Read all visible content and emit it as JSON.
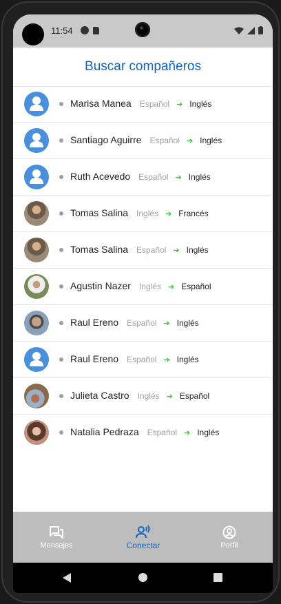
{
  "status_bar": {
    "time": "11:54"
  },
  "header": {
    "title": "Buscar compañeros"
  },
  "colors": {
    "accent": "#1565c0",
    "arrow": "#3cc43c",
    "avatar_default": "#4a8fdb",
    "nav_bg": "#bdbdbd"
  },
  "partners": [
    {
      "name": "Marisa Manea",
      "from": "Español",
      "to": "Inglés",
      "avatar": "default"
    },
    {
      "name": "Santiago Aguirre",
      "from": "Español",
      "to": "Inglés",
      "avatar": "default"
    },
    {
      "name": "Ruth Acevedo",
      "from": "Español",
      "to": "Inglés",
      "avatar": "default"
    },
    {
      "name": "Tomas Salina",
      "from": "Inglés",
      "to": "Francés",
      "avatar": "photo"
    },
    {
      "name": "Tomas Salina",
      "from": "Español",
      "to": "Inglés",
      "avatar": "photo"
    },
    {
      "name": "Agustin Nazer",
      "from": "Inglés",
      "to": "Español",
      "avatar": "photo"
    },
    {
      "name": "Raul Ereno",
      "from": "Español",
      "to": "Inglés",
      "avatar": "photo"
    },
    {
      "name": "Raul Ereno",
      "from": "Español",
      "to": "Inglés",
      "avatar": "default"
    },
    {
      "name": "Julieta Castro",
      "from": "Inglés",
      "to": "Español",
      "avatar": "photo"
    },
    {
      "name": "Natalia Pedraza",
      "from": "Español",
      "to": "Inglés",
      "avatar": "photo"
    }
  ],
  "bottom_nav": {
    "items": [
      {
        "label": "Mensajes",
        "icon": "chat-icon",
        "active": false
      },
      {
        "label": "Conectar",
        "icon": "connect-icon",
        "active": true
      },
      {
        "label": "Perfil",
        "icon": "profile-icon",
        "active": false
      }
    ]
  }
}
